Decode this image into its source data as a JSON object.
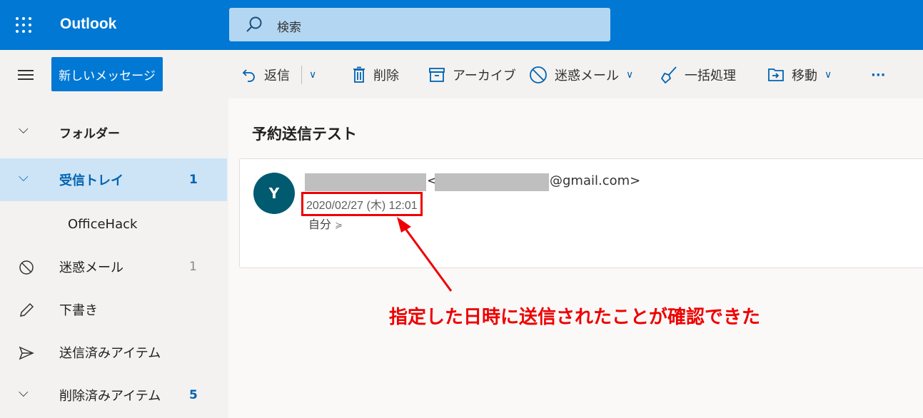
{
  "header": {
    "app_title": "Outlook",
    "search_placeholder": "検索"
  },
  "toolbar": {
    "new_message": "新しいメッセージ",
    "reply": "返信",
    "delete": "削除",
    "archive": "アーカイブ",
    "junk": "迷惑メール",
    "sweep": "一括処理",
    "move": "移動",
    "more": "···"
  },
  "sidebar": {
    "items": [
      {
        "label": "フォルダー",
        "icon": "chevron-down-icon",
        "count": ""
      },
      {
        "label": "受信トレイ",
        "icon": "chevron-down-icon",
        "count": "1"
      },
      {
        "label": "OfficeHack",
        "icon": "",
        "count": ""
      },
      {
        "label": "迷惑メール",
        "icon": "block-icon",
        "count": "1"
      },
      {
        "label": "下書き",
        "icon": "pencil-icon",
        "count": ""
      },
      {
        "label": "送信済みアイテム",
        "icon": "send-icon",
        "count": ""
      },
      {
        "label": "削除済みアイテム",
        "icon": "chevron-down-icon",
        "count": "5"
      }
    ]
  },
  "message": {
    "subject": "予約送信テスト",
    "avatar_initial": "Y",
    "from_open": "<",
    "from_domain": "@gmail.com>",
    "date": "2020/02/27 (木) 12:01",
    "to": "自分"
  },
  "annotation": {
    "text": "指定した日時に送信されたことが確認できた",
    "color": "#ee0000"
  },
  "colors": {
    "brand": "#0078d4",
    "selected": "#cce4f6",
    "avatar": "#005b70"
  }
}
